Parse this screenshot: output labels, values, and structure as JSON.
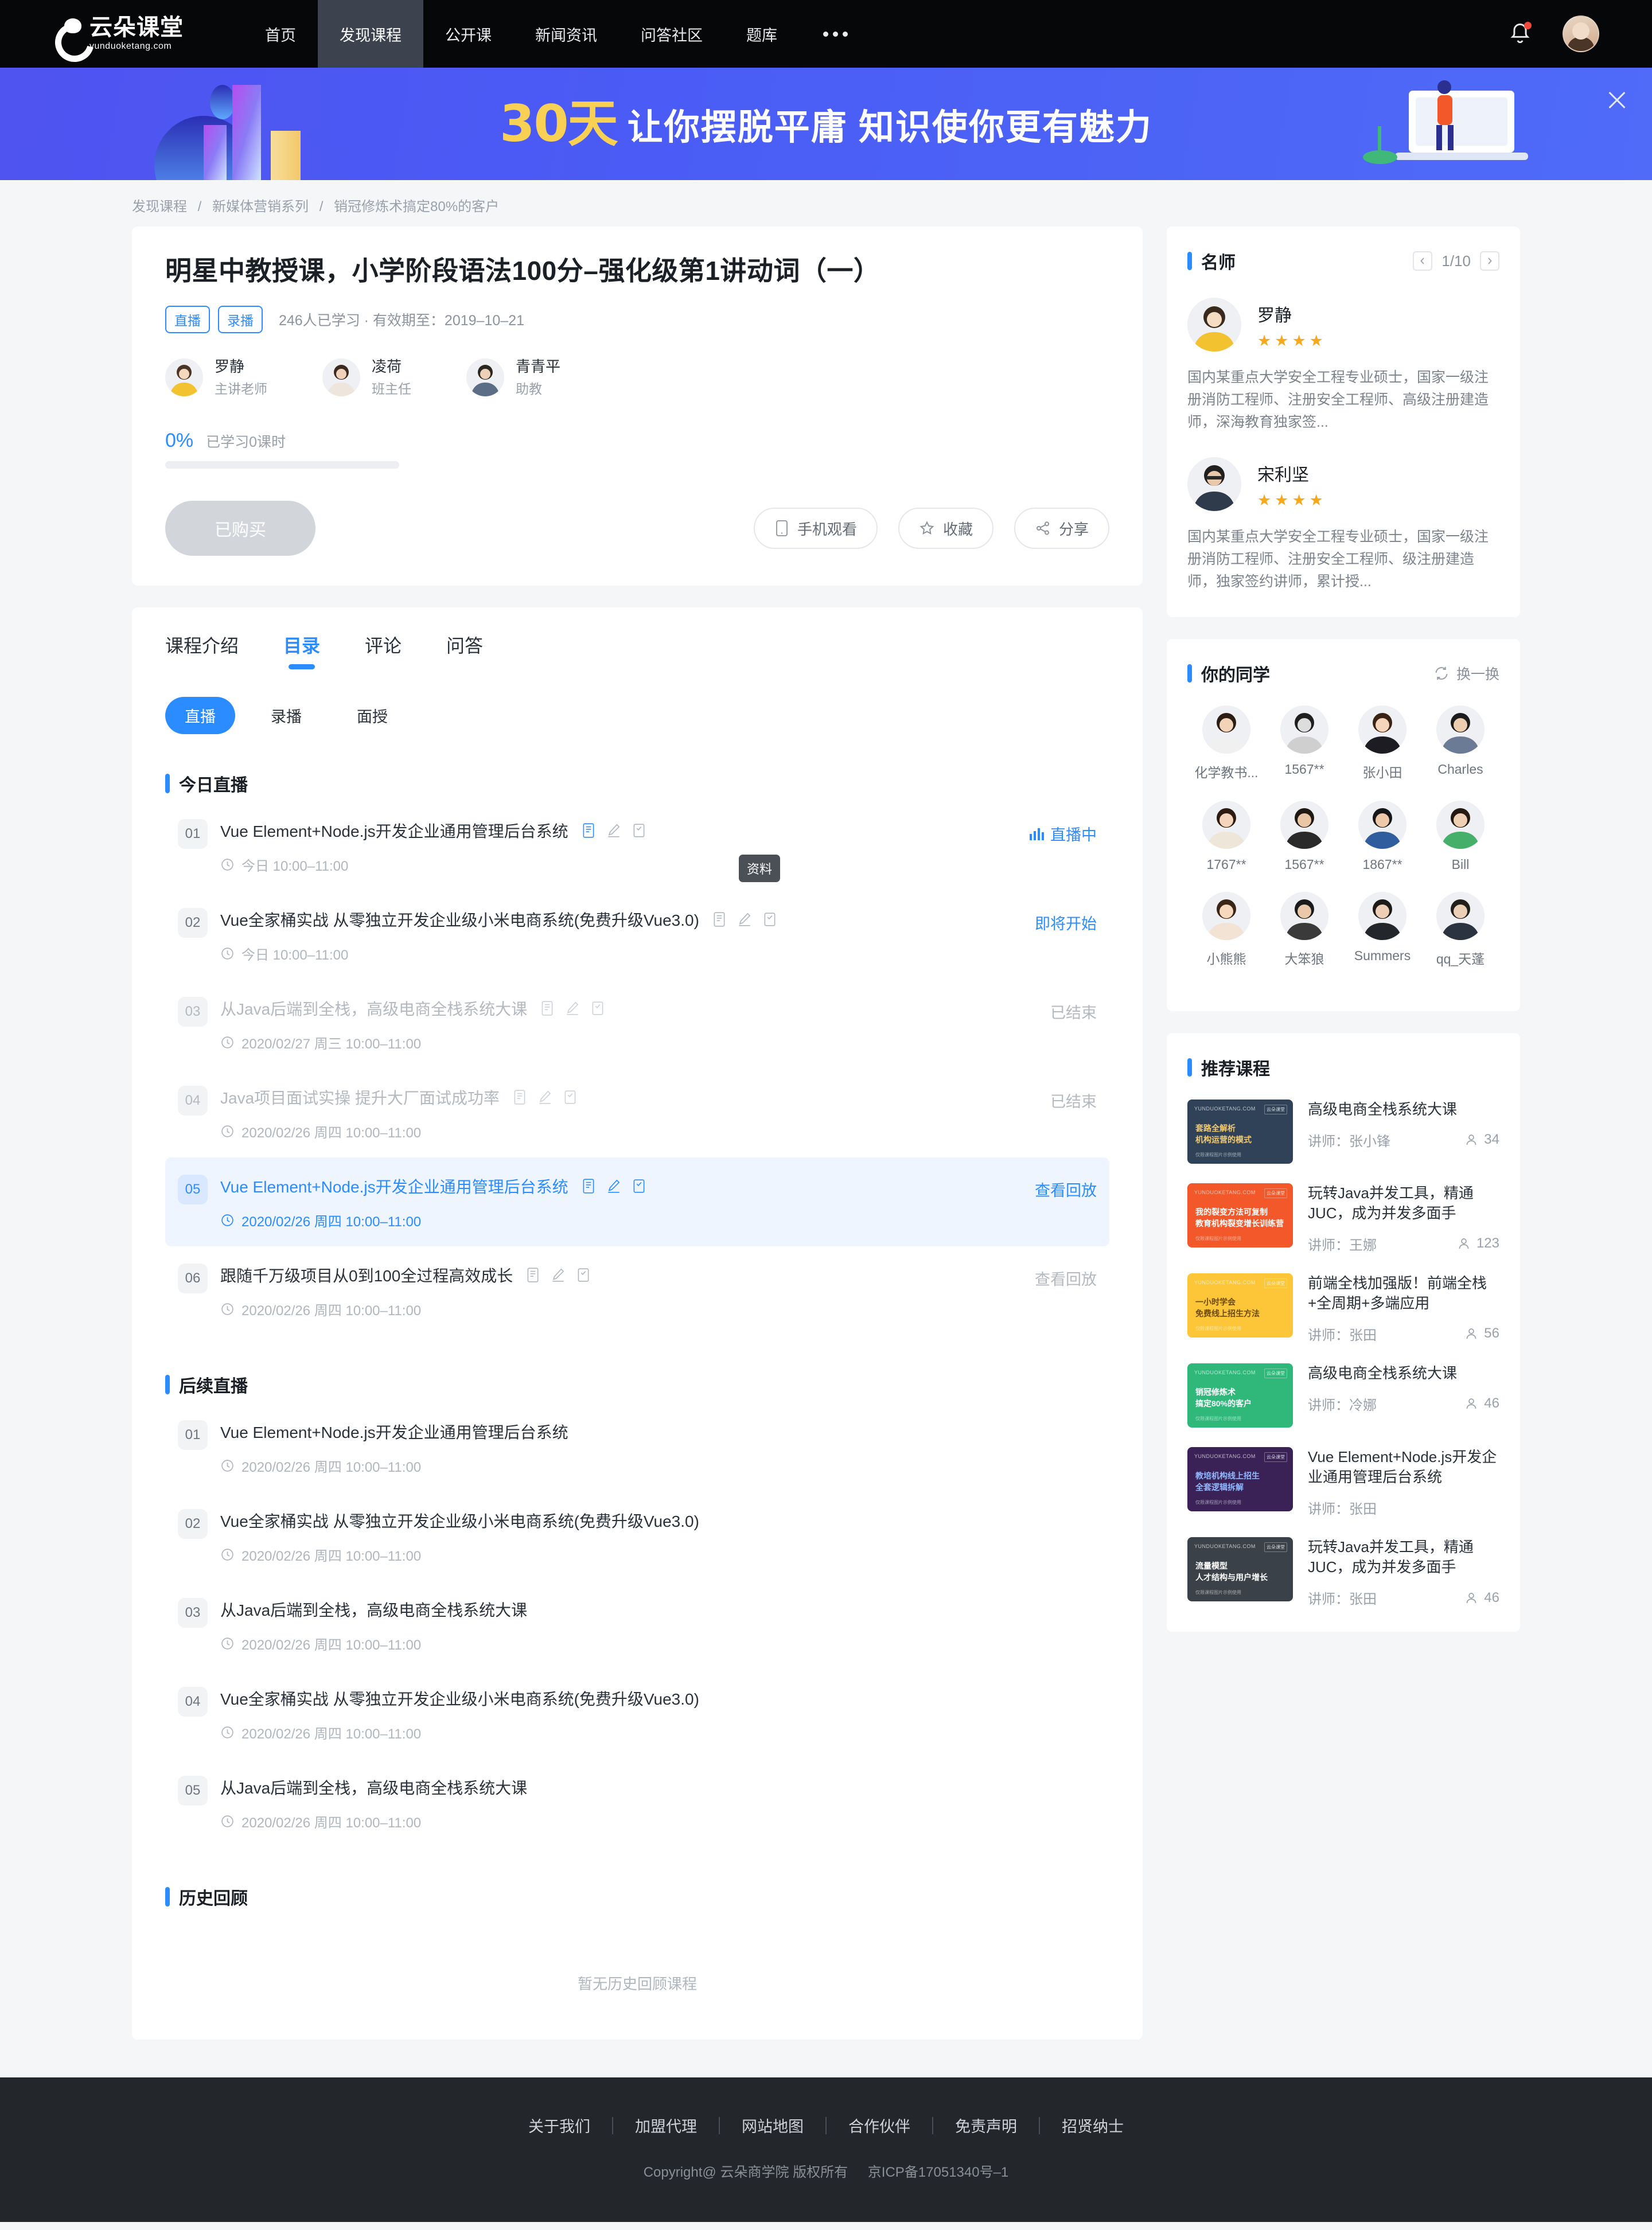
{
  "nav": {
    "logo_main": "云朵课堂",
    "logo_sub": "yunduoketang.com",
    "items": [
      {
        "label": "首页",
        "active": false
      },
      {
        "label": "发现课程",
        "active": true
      },
      {
        "label": "公开课",
        "active": false
      },
      {
        "label": "新闻资讯",
        "active": false
      },
      {
        "label": "问答社区",
        "active": false
      },
      {
        "label": "题库",
        "active": false
      }
    ],
    "more_icon": "ellipsis-icon",
    "bell_icon": "bell-icon",
    "avatar_icon": "user-avatar"
  },
  "banner": {
    "highlight": "30天",
    "text": "让你摆脱平庸  知识使你更有魅力",
    "close_icon": "close-icon"
  },
  "breadcrumb": [
    "发现课程",
    "新媒体营销系列",
    "销冠修炼术搞定80%的客户"
  ],
  "course": {
    "title": "明星中教授课，小学阶段语法100分–强化级第1讲动词（一）",
    "tags": [
      "直播",
      "录播"
    ],
    "meta": "246人已学习 · 有效期至：2019–10–21",
    "teachers": [
      {
        "name": "罗静",
        "role": "主讲老师"
      },
      {
        "name": "凌荷",
        "role": "班主任"
      },
      {
        "name": "青青平",
        "role": "助教"
      }
    ],
    "progress_pct": "0%",
    "progress_value": 0,
    "progress_label": "已学习0课时",
    "buy_label": "已购买",
    "actions": [
      {
        "label": "手机观看",
        "icon": "phone-icon"
      },
      {
        "label": "收藏",
        "icon": "star-icon"
      },
      {
        "label": "分享",
        "icon": "share-icon"
      }
    ]
  },
  "tabs": [
    {
      "label": "课程介绍",
      "active": false
    },
    {
      "label": "目录",
      "active": true
    },
    {
      "label": "评论",
      "active": false
    },
    {
      "label": "问答",
      "active": false
    }
  ],
  "subtabs": [
    {
      "label": "直播",
      "active": true
    },
    {
      "label": "录播",
      "active": false
    },
    {
      "label": "面授",
      "active": false
    }
  ],
  "tooltip": "资料",
  "sections": [
    {
      "title": "今日直播",
      "lessons": [
        {
          "no": "01",
          "title": "Vue Element+Node.js开发企业通用管理后台系统",
          "time": "今日 10:00–11:00",
          "status": "直播中",
          "status_type": "live",
          "icons": [
            "doc-icon",
            "pen-icon",
            "note-icon"
          ],
          "state": "normal"
        },
        {
          "no": "02",
          "title": "Vue全家桶实战 从零独立开发企业级小米电商系统(免费升级Vue3.0)",
          "time": "今日 10:00–11:00",
          "status": "即将开始",
          "status_type": "soon",
          "icons": [
            "doc-icon",
            "pen-icon",
            "note-icon"
          ],
          "state": "normal"
        },
        {
          "no": "03",
          "title": "从Java后端到全栈，高级电商全栈系统大课",
          "time": "2020/02/27 周三 10:00–11:00",
          "status": "已结束",
          "status_type": "ended",
          "icons": [
            "doc-icon",
            "pen-icon",
            "note-icon"
          ],
          "state": "dim"
        },
        {
          "no": "04",
          "title": "Java项目面试实操 提升大厂面试成功率",
          "time": "2020/02/26 周四 10:00–11:00",
          "status": "已结束",
          "status_type": "ended",
          "icons": [
            "doc-icon",
            "pen-icon",
            "note-icon"
          ],
          "state": "dim"
        },
        {
          "no": "05",
          "title": "Vue Element+Node.js开发企业通用管理后台系统",
          "time": "2020/02/26 周四 10:00–11:00",
          "status": "查看回放",
          "status_type": "replay-on",
          "icons": [
            "doc-icon",
            "pen-icon",
            "note-icon"
          ],
          "state": "highlight"
        },
        {
          "no": "06",
          "title": "跟随千万级项目从0到100全过程高效成长",
          "time": "2020/02/26 周四 10:00–11:00",
          "status": "查看回放",
          "status_type": "ended",
          "icons": [
            "doc-icon",
            "pen-icon",
            "note-icon"
          ],
          "state": "normal"
        }
      ]
    },
    {
      "title": "后续直播",
      "lessons": [
        {
          "no": "01",
          "title": "Vue Element+Node.js开发企业通用管理后台系统",
          "time": "2020/02/26 周四 10:00–11:00",
          "status": "",
          "status_type": "none",
          "icons": [],
          "state": "normal"
        },
        {
          "no": "02",
          "title": "Vue全家桶实战 从零独立开发企业级小米电商系统(免费升级Vue3.0)",
          "time": "2020/02/26 周四 10:00–11:00",
          "status": "",
          "status_type": "none",
          "icons": [],
          "state": "normal"
        },
        {
          "no": "03",
          "title": "从Java后端到全栈，高级电商全栈系统大课",
          "time": "2020/02/26 周四 10:00–11:00",
          "status": "",
          "status_type": "none",
          "icons": [],
          "state": "normal"
        },
        {
          "no": "04",
          "title": "Vue全家桶实战 从零独立开发企业级小米电商系统(免费升级Vue3.0)",
          "time": "2020/02/26 周四 10:00–11:00",
          "status": "",
          "status_type": "none",
          "icons": [],
          "state": "normal"
        },
        {
          "no": "05",
          "title": "从Java后端到全栈，高级电商全栈系统大课",
          "time": "2020/02/26 周四 10:00–11:00",
          "status": "",
          "status_type": "none",
          "icons": [],
          "state": "normal"
        }
      ]
    },
    {
      "title": "历史回顾",
      "lessons": [],
      "empty": "暂无历史回顾课程"
    }
  ],
  "sidebar": {
    "teachers_panel": {
      "title": "名师",
      "page": "1/10",
      "prev_icon": "chevron-left-icon",
      "next_icon": "chevron-right-icon",
      "items": [
        {
          "name": "罗静",
          "stars": 4,
          "desc": "国内某重点大学安全工程专业硕士，国家一级注册消防工程师、注册安全工程师、高级注册建造师，深海教育独家签..."
        },
        {
          "name": "宋利坚",
          "stars": 4,
          "desc": "国内某重点大学安全工程专业硕士，国家一级注册消防工程师、注册安全工程师、级注册建造师，独家签约讲师，累计授..."
        }
      ]
    },
    "classmates_panel": {
      "title": "你的同学",
      "refresh_label": "换一换",
      "refresh_icon": "refresh-icon",
      "items": [
        {
          "name": "化学教书..."
        },
        {
          "name": "1567**"
        },
        {
          "name": "张小田"
        },
        {
          "name": "Charles"
        },
        {
          "name": "1767**"
        },
        {
          "name": "1567**"
        },
        {
          "name": "1867**"
        },
        {
          "name": "Bill"
        },
        {
          "name": "小熊熊"
        },
        {
          "name": "大笨狼"
        },
        {
          "name": "Summers"
        },
        {
          "name": "qq_天蓬"
        }
      ]
    },
    "recommend_panel": {
      "title": "推荐课程",
      "items": [
        {
          "title": "高级电商全栈系统大课",
          "teacher": "讲师：张小锋",
          "count": "34",
          "thumb_color": "#2f4258",
          "thumb_l1": "套路全解析",
          "thumb_l2": "机构运营的模式",
          "thumb_accent": "#f5c96a",
          "thumb_top": "YUNDUOKETANG.COM",
          "thumb_badge": "云朵课堂",
          "thumb_foot": "仅限课程图片示例使用"
        },
        {
          "title": "玩转Java并发工具，精通JUC，成为并发多面手",
          "teacher": "讲师：王娜",
          "count": "123",
          "thumb_color": "#f2582a",
          "thumb_l1": "我的裂变方法可复制",
          "thumb_l2": "教育机构裂变增长训练营",
          "thumb_accent": "#ffffff",
          "thumb_top": "YUNDUOKETANG.COM",
          "thumb_badge": "云朵课堂",
          "thumb_foot": "仅限课程图片示例使用"
        },
        {
          "title": "前端全栈加强版！前端全栈+全周期+多端应用",
          "teacher": "讲师：张田",
          "count": "56",
          "thumb_color": "#fcc638",
          "thumb_l1": "一小时学会",
          "thumb_l2": "免费线上招生方法",
          "thumb_accent": "#6b4a08",
          "thumb_top": "YUNDUOKETANG.COM",
          "thumb_badge": "云朵课堂",
          "thumb_foot": "仅限课程图片示例使用"
        },
        {
          "title": "高级电商全栈系统大课",
          "teacher": "讲师：冷娜",
          "count": "46",
          "thumb_color": "#2fb87a",
          "thumb_l1": "销冠修炼术",
          "thumb_l2": "搞定80%的客户",
          "thumb_accent": "#ffffff",
          "thumb_top": "YUNDUOKETANG.COM",
          "thumb_badge": "云朵课堂",
          "thumb_foot": "仅限课程图片示例使用"
        },
        {
          "title": "Vue Element+Node.js开发企业通用管理后台系统",
          "teacher": "讲师：张田",
          "count": "",
          "thumb_color": "#3a2257",
          "thumb_l1": "教培机构线上招生",
          "thumb_l2": "全套逻辑拆解",
          "thumb_accent": "#8fb8ff",
          "thumb_top": "YUNDUOKETANG.COM",
          "thumb_badge": "云朵课堂",
          "thumb_foot": "仅限课程图片示例使用"
        },
        {
          "title": "玩转Java并发工具，精通JUC，成为并发多面手",
          "teacher": "讲师：张田",
          "count": "46",
          "thumb_color": "#3b4148",
          "thumb_l1": "流量模型",
          "thumb_l2": "人才结构与用户增长",
          "thumb_accent": "#ffffff",
          "thumb_top": "YUNDUOKETANG.COM",
          "thumb_badge": "云朵课堂",
          "thumb_foot": "仅限课程图片示例使用"
        }
      ]
    }
  },
  "footer": {
    "links": [
      "关于我们",
      "加盟代理",
      "网站地图",
      "合作伙伴",
      "免责声明",
      "招贤纳士"
    ],
    "copyright": "Copyright@ 云朵商学院  版权所有",
    "icp": "京ICP备17051340号–1"
  },
  "colors": {
    "accent": "#2b8cff",
    "banner_bg": "#4a5cf5",
    "banner_highlight": "#f7d054",
    "nav_bg": "#050709",
    "footer_bg": "#23262b"
  }
}
